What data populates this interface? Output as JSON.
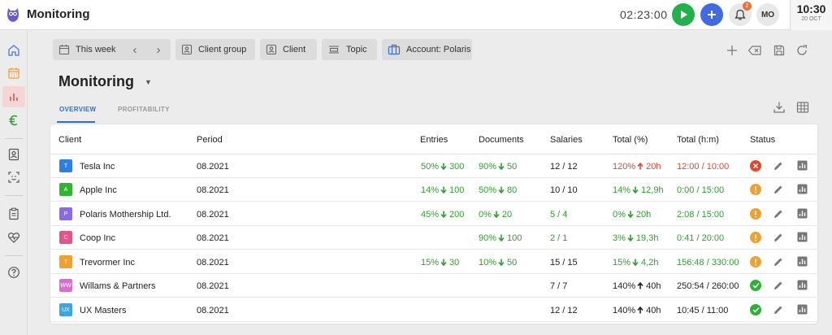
{
  "app": {
    "title": "Monitoring"
  },
  "header": {
    "timer": "02:23:00",
    "notifications": "2",
    "avatar": "MO",
    "clock_time": "10:30",
    "clock_date": "20 OCT"
  },
  "filters": [
    {
      "label": "This week",
      "icon": "calendar-icon"
    },
    {
      "label": "Client group",
      "icon": "client-group-icon"
    },
    {
      "label": "Client",
      "icon": "client-icon"
    },
    {
      "label": "Topic",
      "icon": "topic-icon"
    },
    {
      "label": "Account: Polaris",
      "icon": "briefcase-icon"
    }
  ],
  "page": {
    "title": "Monitoring"
  },
  "tabs": [
    {
      "label": "OVERVIEW",
      "active": true
    },
    {
      "label": "PROFITABILITY",
      "active": false
    }
  ],
  "table": {
    "columns": [
      "Client",
      "Period",
      "Entries",
      "Documents",
      "Salaries",
      "Total (%)",
      "Total (h:m)",
      "Status"
    ],
    "rows": [
      {
        "badge": "T",
        "badge_color": "#2f7fe3",
        "client": "Tesla Inc",
        "period": "08.2021",
        "entries_pct": "50%",
        "entries_val": "300",
        "documents_pct": "90%",
        "documents_val": "50",
        "salaries": "12 / 12",
        "salaries_color": "#222",
        "total_pct": "120%",
        "total_dir": "up",
        "total_val": "20h",
        "total_color": "#e0472c",
        "total_hm": "12:00 / 10:00",
        "hm_color": "#e0472c",
        "status": "error"
      },
      {
        "badge": "A",
        "badge_color": "#30b530",
        "client": "Apple Inc",
        "period": "08.2021",
        "entries_pct": "14%",
        "entries_val": "100",
        "documents_pct": "50%",
        "documents_val": "80",
        "salaries": "10 / 10",
        "salaries_color": "#222",
        "total_pct": "14%",
        "total_dir": "down",
        "total_val": "12,9h",
        "total_color": "#2e9e2e",
        "total_hm": "0:00 / 15:00",
        "hm_color": "#2e9e2e",
        "status": "warning"
      },
      {
        "badge": "P",
        "badge_color": "#8a6be6",
        "client": "Polaris Mothership Ltd.",
        "period": "08.2021",
        "entries_pct": "45%",
        "entries_val": "200",
        "documents_pct": "0%",
        "documents_val": "20",
        "salaries": "5 / 4",
        "salaries_color": "#2e9e2e",
        "total_pct": "0%",
        "total_dir": "down",
        "total_val": "20h",
        "total_color": "#2e9e2e",
        "total_hm": "2:08 / 15:00",
        "hm_color": "#2e9e2e",
        "status": "warning"
      },
      {
        "badge": "C",
        "badge_color": "#e0568a",
        "client": "Coop Inc",
        "period": "08.2021",
        "entries_pct": "",
        "entries_val": "",
        "documents_pct": "90%",
        "documents_val": "100",
        "salaries": "2 / 1",
        "salaries_color": "#2e9e2e",
        "total_pct": "3%",
        "total_dir": "down",
        "total_val": "19,3h",
        "total_color": "#2e9e2e",
        "total_hm": "0:41 / 20:00",
        "hm_color": "#2e9e2e",
        "status": "warning"
      },
      {
        "badge": "T",
        "badge_color": "#f0a030",
        "client": "Trevormer Inc",
        "period": "08.2021",
        "entries_pct": "15%",
        "entries_val": "30",
        "documents_pct": "10%",
        "documents_val": "50",
        "salaries": "15 / 15",
        "salaries_color": "#222",
        "total_pct": "15%",
        "total_dir": "down",
        "total_val": "4,2h",
        "total_color": "#2e9e2e",
        "total_hm": "156:48 / 330:00",
        "hm_color": "#2e9e2e",
        "status": "warning"
      },
      {
        "badge": "WW",
        "badge_color": "#d86fd0",
        "client": "Willams & Partners",
        "period": "08.2021",
        "entries_pct": "",
        "entries_val": "",
        "documents_pct": "",
        "documents_val": "",
        "salaries": "7 / 7",
        "salaries_color": "#222",
        "total_pct": "140%",
        "total_dir": "up",
        "total_val": "40h",
        "total_color": "#222",
        "total_hm": "250:54 / 260:00",
        "hm_color": "#222",
        "status": "ok"
      },
      {
        "badge": "UX",
        "badge_color": "#3aa7e0",
        "client": "UX Masters",
        "period": "08.2021",
        "entries_pct": "",
        "entries_val": "",
        "documents_pct": "",
        "documents_val": "",
        "salaries": "12 / 12",
        "salaries_color": "#222",
        "total_pct": "140%",
        "total_dir": "up",
        "total_val": "40h",
        "total_color": "#222",
        "total_hm": "10:45 / 11:00",
        "hm_color": "#222",
        "status": "ok"
      }
    ]
  },
  "colors": {
    "accent": "#2b6fd6",
    "positive": "#2e9e2e",
    "negative": "#e0472c",
    "warning": "#f0a030",
    "ok": "#2eae3a",
    "play": "#23b14d",
    "add": "#4169e1"
  }
}
